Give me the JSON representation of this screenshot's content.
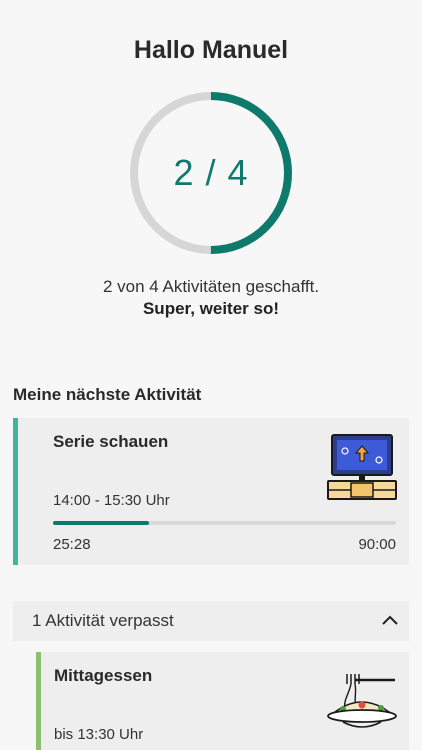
{
  "header": {
    "greeting": "Hallo Manuel"
  },
  "progress_ring": {
    "text": "2 / 4",
    "completed": 2,
    "total": 4,
    "color": "#0e7a6c",
    "track_color": "#d6d6d6"
  },
  "summary": {
    "line1": "2 von 4 Aktivitäten geschafft.",
    "line2": "Super, weiter so!"
  },
  "next_activity": {
    "section_title": "Meine nächste Aktivität",
    "title": "Serie schauen",
    "time": "14:00 - 15:30 Uhr",
    "elapsed": "25:28",
    "duration": "90:00",
    "progress_fraction": 0.28,
    "accent_color": "#3fb59f",
    "icon": "tv-icon"
  },
  "missed": {
    "label": "1 Aktivität verpasst",
    "expanded": true,
    "items": [
      {
        "title": "Mittagessen",
        "time": "bis 13:30 Uhr",
        "accent_color": "#8ac16a",
        "icon": "food-plate-icon"
      }
    ]
  }
}
